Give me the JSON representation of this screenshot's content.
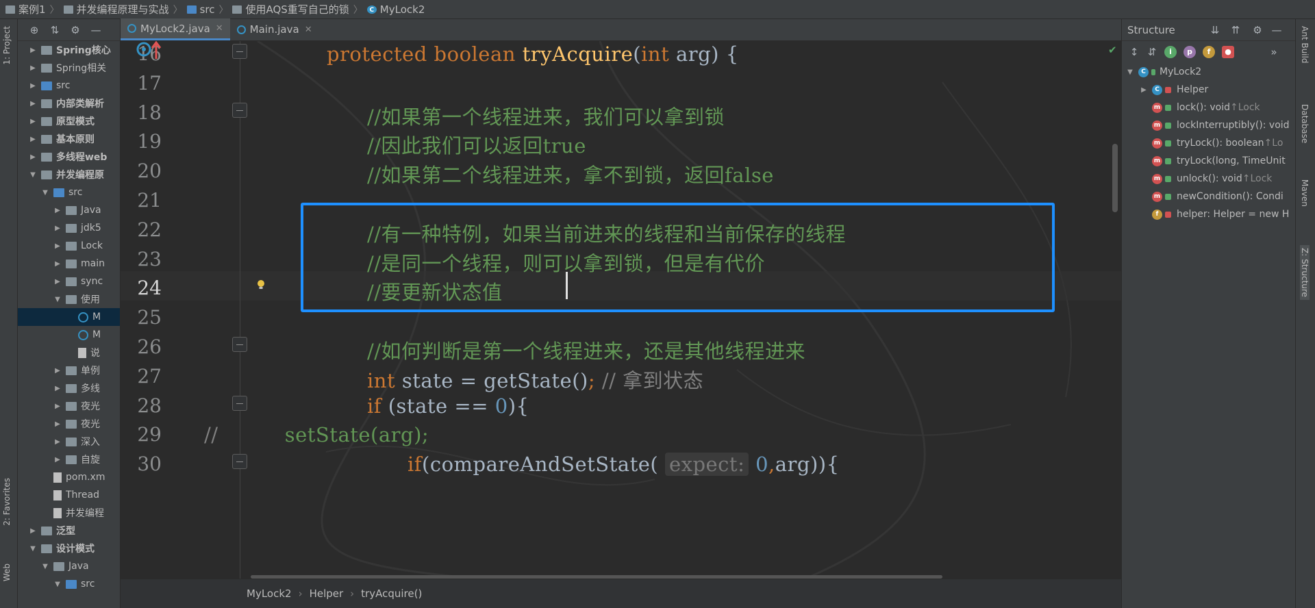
{
  "navbar": {
    "crumbs": [
      "案例1",
      "并发编程原理与实战",
      "src",
      "使用AQS重写自己的锁",
      "MyLock2"
    ]
  },
  "left_strip": {
    "project": "1: Project",
    "favorites": "2: Favorites",
    "web": "Web"
  },
  "project_tree": [
    {
      "label": "Spring核心",
      "indent": 1,
      "arrow": "▶",
      "icon": "folder",
      "bold": true
    },
    {
      "label": "Spring相关",
      "indent": 1,
      "arrow": "▶",
      "icon": "folder",
      "bold": false
    },
    {
      "label": "src",
      "indent": 1,
      "arrow": "▶",
      "icon": "folder-blue",
      "bold": false
    },
    {
      "label": "内部类解析",
      "indent": 1,
      "arrow": "▶",
      "icon": "folder",
      "bold": true
    },
    {
      "label": "原型模式",
      "indent": 1,
      "arrow": "▶",
      "icon": "folder",
      "bold": true
    },
    {
      "label": "基本原则",
      "indent": 1,
      "arrow": "▶",
      "icon": "folder",
      "bold": true
    },
    {
      "label": "多线程web",
      "indent": 1,
      "arrow": "▶",
      "icon": "folder",
      "bold": true
    },
    {
      "label": "并发编程原",
      "indent": 1,
      "arrow": "▼",
      "icon": "folder",
      "bold": true
    },
    {
      "label": "src",
      "indent": 2,
      "arrow": "▼",
      "icon": "folder-blue",
      "bold": false
    },
    {
      "label": "Java",
      "indent": 3,
      "arrow": "▶",
      "icon": "folder",
      "bold": false
    },
    {
      "label": "jdk5",
      "indent": 3,
      "arrow": "▶",
      "icon": "folder",
      "bold": false
    },
    {
      "label": "Lock",
      "indent": 3,
      "arrow": "▶",
      "icon": "folder",
      "bold": false
    },
    {
      "label": "main",
      "indent": 3,
      "arrow": "▶",
      "icon": "folder",
      "bold": false
    },
    {
      "label": "sync",
      "indent": 3,
      "arrow": "▶",
      "icon": "folder",
      "bold": false
    },
    {
      "label": "使用",
      "indent": 3,
      "arrow": "▼",
      "icon": "folder",
      "bold": false
    },
    {
      "label": "M",
      "indent": 4,
      "arrow": "",
      "icon": "class",
      "bold": false,
      "selected": true
    },
    {
      "label": "M",
      "indent": 4,
      "arrow": "",
      "icon": "class",
      "bold": false
    },
    {
      "label": "说",
      "indent": 4,
      "arrow": "",
      "icon": "file",
      "bold": false
    },
    {
      "label": "单例",
      "indent": 3,
      "arrow": "▶",
      "icon": "folder",
      "bold": false
    },
    {
      "label": "多线",
      "indent": 3,
      "arrow": "▶",
      "icon": "folder",
      "bold": false
    },
    {
      "label": "夜光",
      "indent": 3,
      "arrow": "▶",
      "icon": "folder",
      "bold": false
    },
    {
      "label": "夜光",
      "indent": 3,
      "arrow": "▶",
      "icon": "folder",
      "bold": false
    },
    {
      "label": "深入",
      "indent": 3,
      "arrow": "▶",
      "icon": "folder",
      "bold": false
    },
    {
      "label": "自旋",
      "indent": 3,
      "arrow": "▶",
      "icon": "folder",
      "bold": false
    },
    {
      "label": "pom.xm",
      "indent": 2,
      "arrow": "",
      "icon": "file",
      "bold": false
    },
    {
      "label": "Thread",
      "indent": 2,
      "arrow": "",
      "icon": "file",
      "bold": false
    },
    {
      "label": "并发编程",
      "indent": 2,
      "arrow": "",
      "icon": "file",
      "bold": false
    },
    {
      "label": "泛型",
      "indent": 1,
      "arrow": "▶",
      "icon": "folder",
      "bold": true
    },
    {
      "label": "设计模式",
      "indent": 1,
      "arrow": "▼",
      "icon": "folder",
      "bold": true
    },
    {
      "label": "Java",
      "indent": 2,
      "arrow": "▼",
      "icon": "folder",
      "bold": false
    },
    {
      "label": "src",
      "indent": 3,
      "arrow": "▼",
      "icon": "folder-blue",
      "bold": false
    }
  ],
  "tabs": [
    {
      "label": "MyLock2.java",
      "active": true
    },
    {
      "label": "Main.java",
      "active": false
    }
  ],
  "code_lines": [
    {
      "num": "16",
      "html": "<span class='kw'>protected boolean </span><span class='fn'>tryAcquire</span>(<span class='kw'>int </span>arg) {",
      "indent": 1
    },
    {
      "num": "17",
      "html": "",
      "indent": 0
    },
    {
      "num": "18",
      "html": "<span class='cm'>//如果第一个线程进来，我们可以拿到锁</span>",
      "indent": 2
    },
    {
      "num": "19",
      "html": "<span class='cm'>//因此我们可以返回true</span>",
      "indent": 2
    },
    {
      "num": "20",
      "html": "<span class='cm'>//如果第二个线程进来，拿不到锁，返回false</span>",
      "indent": 2
    },
    {
      "num": "21",
      "html": "",
      "indent": 0
    },
    {
      "num": "22",
      "html": "<span class='cm'>//有一种特例，如果当前进来的线程和当前保存的线程</span>",
      "indent": 2
    },
    {
      "num": "23",
      "html": "<span class='cm'>//是同一个线程，则可以拿到锁，但是有代价</span>",
      "indent": 2
    },
    {
      "num": "24",
      "html": "<span class='cm'>//要更新状态值</span>",
      "indent": 2
    },
    {
      "num": "25",
      "html": "",
      "indent": 0
    },
    {
      "num": "26",
      "html": "<span class='cm'>//如何判断是第一个线程进来，还是其他线程进来</span>",
      "indent": 2
    },
    {
      "num": "27",
      "html": "<span class='kw'>int </span>state = getState()<span class='kw'>; </span><span class='cm2'>// 拿到状态</span>",
      "indent": 2
    },
    {
      "num": "28",
      "html": "<span class='kw'>if </span>(state == <span class='num'>0</span>){",
      "indent": 2
    },
    {
      "num": "29",
      "html": "<span class='cm2'>//          </span><span class='cm'>setState(arg);</span>",
      "indent": 0
    },
    {
      "num": "30",
      "html": "<span class='kw'>if</span>(compareAndSetState( <span class='hint'>expect:</span> <span class='num'>0</span><span class='kw'>,</span>arg)){",
      "indent": 3
    }
  ],
  "editor_breadcrumb": [
    "MyLock2",
    "Helper",
    "tryAcquire()"
  ],
  "structure": {
    "title": "Structure",
    "root": "MyLock2",
    "items": [
      {
        "type": "class",
        "name": "Helper",
        "suffix": "",
        "arrow": "▶",
        "lock": "red"
      },
      {
        "type": "method",
        "name": "lock(): void ",
        "suffix": "↑Lock",
        "lock": "green"
      },
      {
        "type": "method",
        "name": "lockInterruptibly(): void",
        "suffix": "",
        "lock": "green"
      },
      {
        "type": "method",
        "name": "tryLock(): boolean ",
        "suffix": "↑Lo",
        "lock": "green"
      },
      {
        "type": "method",
        "name": "tryLock(long, TimeUnit",
        "suffix": "",
        "lock": "green"
      },
      {
        "type": "method",
        "name": "unlock(): void ",
        "suffix": "↑Lock",
        "lock": "green"
      },
      {
        "type": "method",
        "name": "newCondition(): Condi",
        "suffix": "",
        "lock": "green"
      },
      {
        "type": "field",
        "name": "helper: Helper = new H",
        "suffix": "",
        "lock": "red"
      }
    ]
  },
  "right_strip": {
    "ant": "Ant Build",
    "database": "Database",
    "maven": "Maven",
    "structure": "Z: Structure"
  }
}
